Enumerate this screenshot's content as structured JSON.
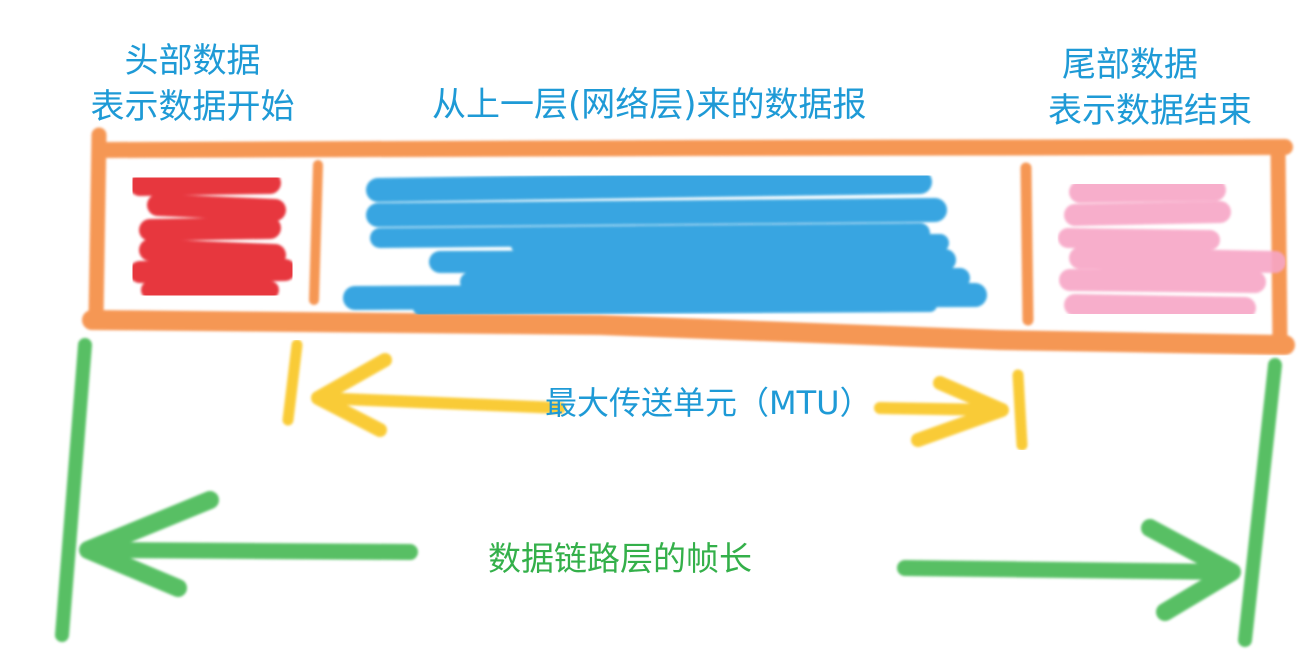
{
  "labels": {
    "header_line1": "头部数据",
    "header_line2": "表示数据开始",
    "payload": "从上一层(网络层)来的数据报",
    "trailer_line1": "尾部数据",
    "trailer_line2": "表示数据结束",
    "mtu": "最大传送单元（MTU）",
    "frame_length": "数据链路层的帧长"
  },
  "colors": {
    "frame_border": "#f58c42",
    "header_block": "#e5222a",
    "payload_block": "#1796dc",
    "trailer_block": "#f7a6c6",
    "mtu_arrow": "#f9c623",
    "frame_arrow": "#3ab54a",
    "label_blue": "#1e9ad6",
    "label_green": "#34b04a"
  }
}
